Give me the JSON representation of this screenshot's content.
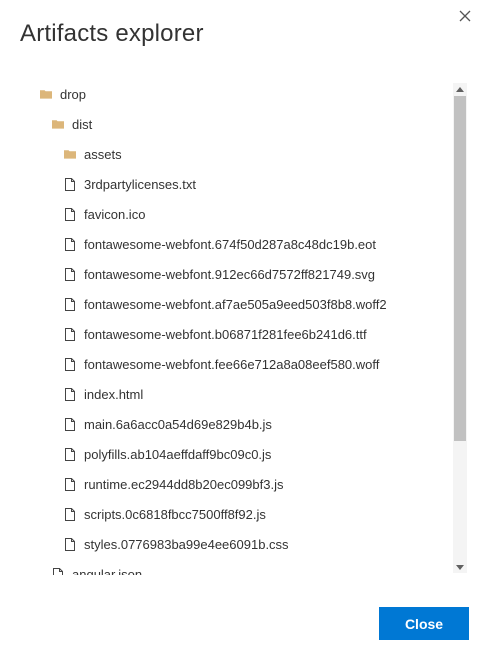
{
  "dialog": {
    "title": "Artifacts explorer",
    "close_button_label": "Close"
  },
  "tree": {
    "items": [
      {
        "label": "drop",
        "type": "folder"
      },
      {
        "label": "dist",
        "type": "folder"
      },
      {
        "label": "assets",
        "type": "folder"
      },
      {
        "label": "3rdpartylicenses.txt",
        "type": "file"
      },
      {
        "label": "favicon.ico",
        "type": "file"
      },
      {
        "label": "fontawesome-webfont.674f50d287a8c48dc19b.eot",
        "type": "file"
      },
      {
        "label": "fontawesome-webfont.912ec66d7572ff821749.svg",
        "type": "file"
      },
      {
        "label": "fontawesome-webfont.af7ae505a9eed503f8b8.woff2",
        "type": "file"
      },
      {
        "label": "fontawesome-webfont.b06871f281fee6b241d6.ttf",
        "type": "file"
      },
      {
        "label": "fontawesome-webfont.fee66e712a8a08eef580.woff",
        "type": "file"
      },
      {
        "label": "index.html",
        "type": "file"
      },
      {
        "label": "main.6a6acc0a54d69e829b4b.js",
        "type": "file"
      },
      {
        "label": "polyfills.ab104aeffdaff9bc09c0.js",
        "type": "file"
      },
      {
        "label": "runtime.ec2944dd8b20ec099bf3.js",
        "type": "file"
      },
      {
        "label": "scripts.0c6818fbcc7500ff8f92.js",
        "type": "file"
      },
      {
        "label": "styles.0776983ba99e4ee6091b.css",
        "type": "file"
      },
      {
        "label": "angular.json",
        "type": "file"
      }
    ]
  },
  "icons": {
    "folder": "folder-icon",
    "file": "file-icon",
    "close": "close-icon"
  },
  "colors": {
    "accent": "#0078d4",
    "folder": "#dcb67a",
    "text": "#333333",
    "scroll_thumb": "#c1c1c1"
  }
}
